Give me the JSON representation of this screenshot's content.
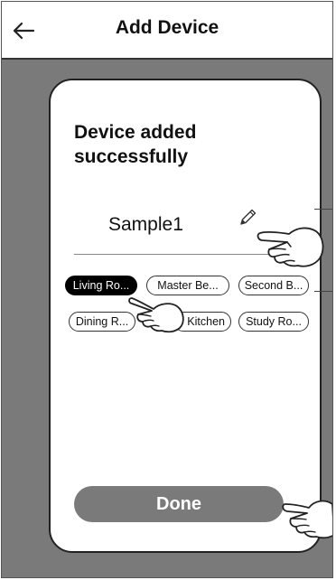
{
  "header": {
    "title": "Add Device",
    "back_icon": "back-arrow-icon"
  },
  "card": {
    "heading": "Device added successfully",
    "device_name": "Sample1",
    "edit_icon": "pencil-icon"
  },
  "rooms": [
    {
      "label": "Living Ro...",
      "selected": true
    },
    {
      "label": "Master Be...",
      "selected": false
    },
    {
      "label": "Second B...",
      "selected": false
    },
    {
      "label": "Dining R...",
      "selected": false
    },
    {
      "label": "Kitchen",
      "selected": false
    },
    {
      "label": "Study Ro...",
      "selected": false
    }
  ],
  "done_button": {
    "label": "Done"
  },
  "colors": {
    "overlay": "#7a7a7a",
    "selected_chip": "#000000",
    "button": "#7a7a7a"
  }
}
